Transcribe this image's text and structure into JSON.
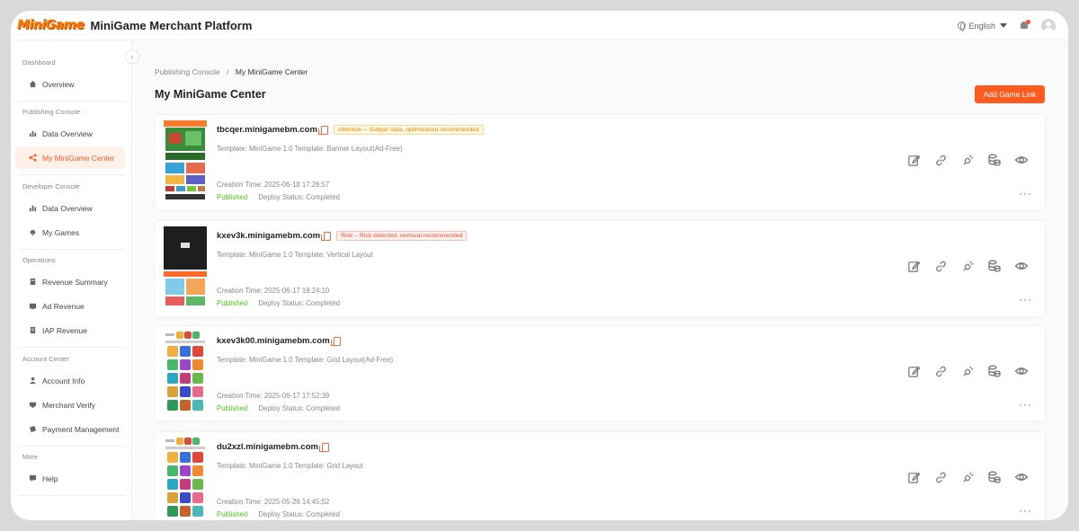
{
  "header": {
    "logo_text": "MiniGame",
    "title": "MiniGame Merchant Platform",
    "language": "English"
  },
  "sidebar": {
    "groups": [
      {
        "title": "Dashboard",
        "items": [
          {
            "label": "Overview",
            "icon": "home-icon"
          }
        ]
      },
      {
        "title": "Publishing Console",
        "items": [
          {
            "label": "Data Overview",
            "icon": "bar-chart-icon"
          },
          {
            "label": "My MiniGame Center",
            "icon": "share-icon",
            "active": true
          }
        ]
      },
      {
        "title": "Developer Console",
        "items": [
          {
            "label": "Data Overview",
            "icon": "bar-chart-icon"
          },
          {
            "label": "My Games",
            "icon": "bell-icon"
          }
        ]
      },
      {
        "title": "Operations",
        "items": [
          {
            "label": "Revenue Summary",
            "icon": "ledger-icon"
          },
          {
            "label": "Ad Revenue",
            "icon": "ad-icon"
          },
          {
            "label": "IAP Revenue",
            "icon": "document-icon"
          }
        ]
      },
      {
        "title": "Account Center",
        "items": [
          {
            "label": "Account Info",
            "icon": "user-icon"
          },
          {
            "label": "Merchant Verify",
            "icon": "verify-icon"
          },
          {
            "label": "Payment Management",
            "icon": "payment-icon"
          }
        ]
      },
      {
        "title": "More",
        "items": [
          {
            "label": "Help",
            "icon": "help-icon"
          }
        ]
      }
    ]
  },
  "main": {
    "breadcrumb": {
      "parent": "Publishing Console",
      "separator": "/",
      "current": "My MiniGame Center"
    },
    "title": "My MiniGame Center",
    "add_button": "Add Game Link",
    "cards": [
      {
        "domain": "tbcqer.minigamebm.com",
        "tag": "Attention – Subpar data, optimization recommended",
        "tag_type": "warn",
        "template": "Template: MiniGame 1.0 Template: Banner Layout(Ad-Free)",
        "created": "Creation Time: 2025-06-18 17:26:57",
        "status": "Published",
        "deploy": "Deploy Status: Completed",
        "thumb": "banner"
      },
      {
        "domain": "kxev3k.minigamebm.com",
        "tag": "Risk – Risk detected, removal recommended",
        "tag_type": "risk",
        "template": "Template: MiniGame 1.0 Template: Vertical Layout",
        "created": "Creation Time: 2025-06-17 18:24:10",
        "status": "Published",
        "deploy": "Deploy Status: Completed",
        "thumb": "vertical"
      },
      {
        "domain": "kxev3k00.minigamebm.com",
        "tag": "",
        "tag_type": "",
        "template": "Template: MiniGame 1.0 Template: Grid Layout(Ad-Free)",
        "created": "Creation Time: 2025-06-17 17:52:39",
        "status": "Published",
        "deploy": "Deploy Status: Completed",
        "thumb": "grid"
      },
      {
        "domain": "du2xzl.minigamebm.com",
        "tag": "",
        "tag_type": "",
        "template": "Template: MiniGame 1.0 Template: Grid Layout",
        "created": "Creation Time: 2025-05-26 14:45:52",
        "status": "Published",
        "deploy": "Deploy Status: Completed",
        "thumb": "grid"
      }
    ],
    "action_icons": [
      "edit-icon",
      "link-icon",
      "plug-icon",
      "coins-icon",
      "eye-icon"
    ],
    "more_label": "···"
  },
  "colors": {
    "accent": "#ff5b1e",
    "published": "#52c41a",
    "warn": "#e38a00",
    "risk": "#e8503a"
  }
}
